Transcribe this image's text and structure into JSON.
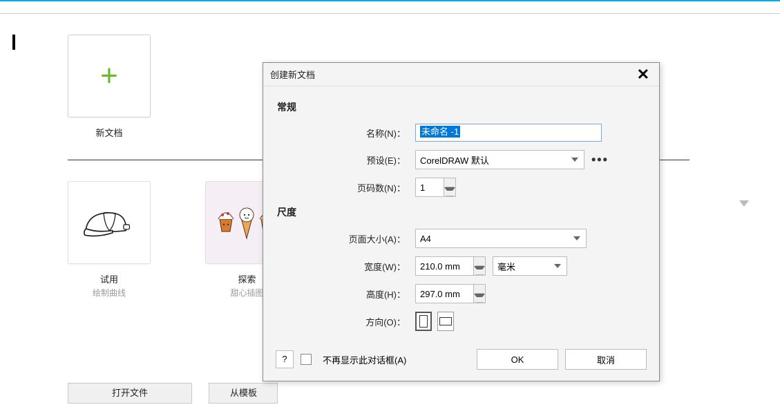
{
  "welcome": {
    "newdoc_label": "新文档",
    "tiles": [
      {
        "title": "试用",
        "subtitle": "绘制曲线"
      },
      {
        "title": "探索",
        "subtitle": "甜心插图"
      }
    ],
    "buttons": {
      "open_file": "打开文件",
      "from_template": "从模板"
    }
  },
  "dialog": {
    "title": "创建新文档",
    "sections": {
      "general": "常规",
      "dimensions": "尺度"
    },
    "labels": {
      "name": "名称(N)：",
      "preset": "预设(E)：",
      "pages": "页码数(N)：",
      "page_size": "页面大小(A)：",
      "width": "宽度(W)：",
      "height": "高度(H)：",
      "orientation": "方向(O)："
    },
    "values": {
      "name": "未命名 -1",
      "preset": "CorelDRAW 默认",
      "pages": "1",
      "page_size": "A4",
      "width": "210.0 mm",
      "height": "297.0 mm",
      "unit": "毫米"
    },
    "footer": {
      "help": "?",
      "dont_show": "不再显示此对话框(A)",
      "ok": "OK",
      "cancel": "取消"
    }
  }
}
